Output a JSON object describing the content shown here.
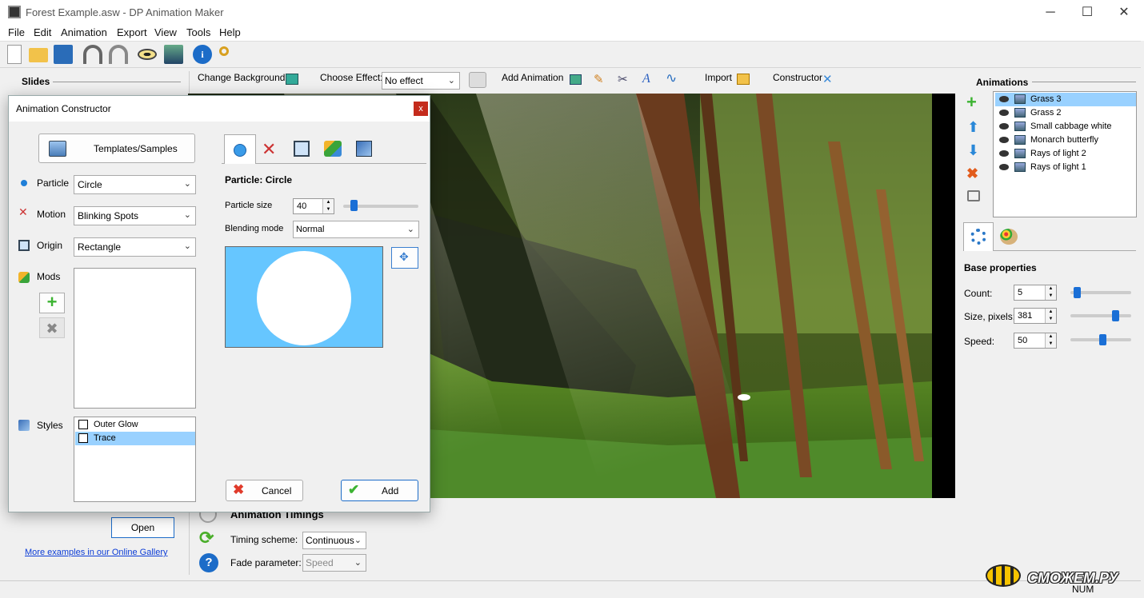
{
  "window": {
    "title": "Forest Example.asw - DP Animation Maker",
    "min": "─",
    "max": "☐",
    "close": "✕"
  },
  "menu": [
    "File",
    "Edit",
    "Animation",
    "Export",
    "View",
    "Tools",
    "Help"
  ],
  "toolbar_icons": [
    "new-icon",
    "open-icon",
    "save-icon",
    "undo-icon",
    "redo-icon",
    "preview-icon",
    "export-icon",
    "info-icon",
    "key-icon"
  ],
  "slides": {
    "title": "Slides"
  },
  "effects_bar": {
    "change_background": "Change Background",
    "choose_effect": "Choose Effect:",
    "effect_value": "No effect",
    "add_animation": "Add Animation",
    "import": "Import",
    "constructor": "Constructor"
  },
  "animations": {
    "title": "Animations",
    "items": [
      {
        "name": "Grass 3",
        "selected": true
      },
      {
        "name": "Grass 2"
      },
      {
        "name": "Small cabbage white"
      },
      {
        "name": "Monarch butterfly"
      },
      {
        "name": "Rays of light 2"
      },
      {
        "name": "Rays of light 1"
      }
    ]
  },
  "properties": {
    "title": "Base properties",
    "count_label": "Count:",
    "count": "5",
    "count_level": 0.05,
    "size_label": "Size, pixels:",
    "size": "381",
    "size_level": 0.72,
    "speed_label": "Speed:",
    "speed": "50",
    "speed_level": 0.5
  },
  "timings": {
    "title": "Animation Timings",
    "scheme_label": "Timing scheme:",
    "scheme": "Continuous",
    "fade_label": "Fade parameter:",
    "fade": "Speed"
  },
  "left_bottom": {
    "open": "Open",
    "gallery_link": "More examples in our Online Gallery"
  },
  "dialog": {
    "title": "Animation Constructor",
    "close": "x",
    "templates": "Templates/Samples",
    "particle_label": "Particle",
    "particle": "Circle",
    "motion_label": "Motion",
    "motion": "Blinking Spots",
    "origin_label": "Origin",
    "origin": "Rectangle",
    "mods_label": "Mods",
    "styles_label": "Styles",
    "styles": [
      {
        "name": "Outer Glow",
        "checked": false
      },
      {
        "name": "Trace",
        "checked": false,
        "selected": true
      }
    ],
    "panel_title": "Particle: Circle",
    "particle_size_label": "Particle size",
    "particle_size": "40",
    "particle_size_level": 0.1,
    "blending_label": "Blending mode",
    "blending": "Normal",
    "cancel": "Cancel",
    "add": "Add",
    "preview_bg": "#66c6ff"
  },
  "statusbar": {
    "num": "NUM"
  },
  "watermark": "СМОЖЕМ.РУ"
}
